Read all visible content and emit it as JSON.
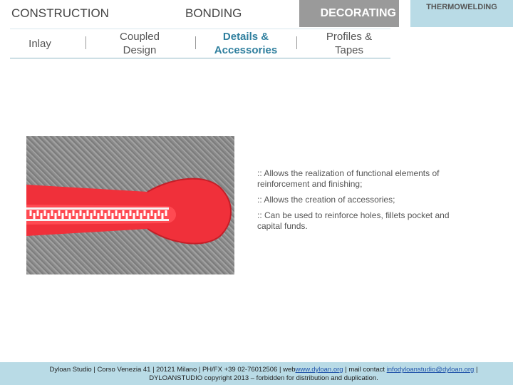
{
  "top_tabs": {
    "construction": "CONSTRUCTION",
    "bonding": "BONDING",
    "decorating": "DECORATING",
    "thermowelding": "THERMOWELDING"
  },
  "sub_nav": {
    "inlay": "Inlay",
    "coupled_design": "Coupled Design",
    "details_accessories": "Details & Accessories",
    "profiles_tapes": "Profiles & Tapes"
  },
  "bullets": [
    ":: Allows the realization of functional elements of reinforcement and finishing;",
    ":: Allows the creation of accessories;",
    ":: Can be used to reinforce holes, fillets pocket and capital funds."
  ],
  "footer": {
    "line1_pre": "Dyloan Studio | Corso Venezia 41 | 20121 Milano | PH/FX +39 02-76012506 | web",
    "web_link": "www.dyloan.org",
    "line1_mid": " | mail contact ",
    "mail_link": "infodyloanstudio@dyloan.org",
    "line1_post": " |",
    "line2": "DYLOANSTUDIO copyright 2013 – forbidden for distribution and duplication."
  },
  "colors": {
    "decorating_bg": "#9a9a9a",
    "thermo_bg": "#b9dbe6",
    "active_subnav": "#2f7f9e",
    "footer_bg": "#b9dbe6"
  },
  "image": {
    "subject": "red zipper puller on grey fabric"
  }
}
